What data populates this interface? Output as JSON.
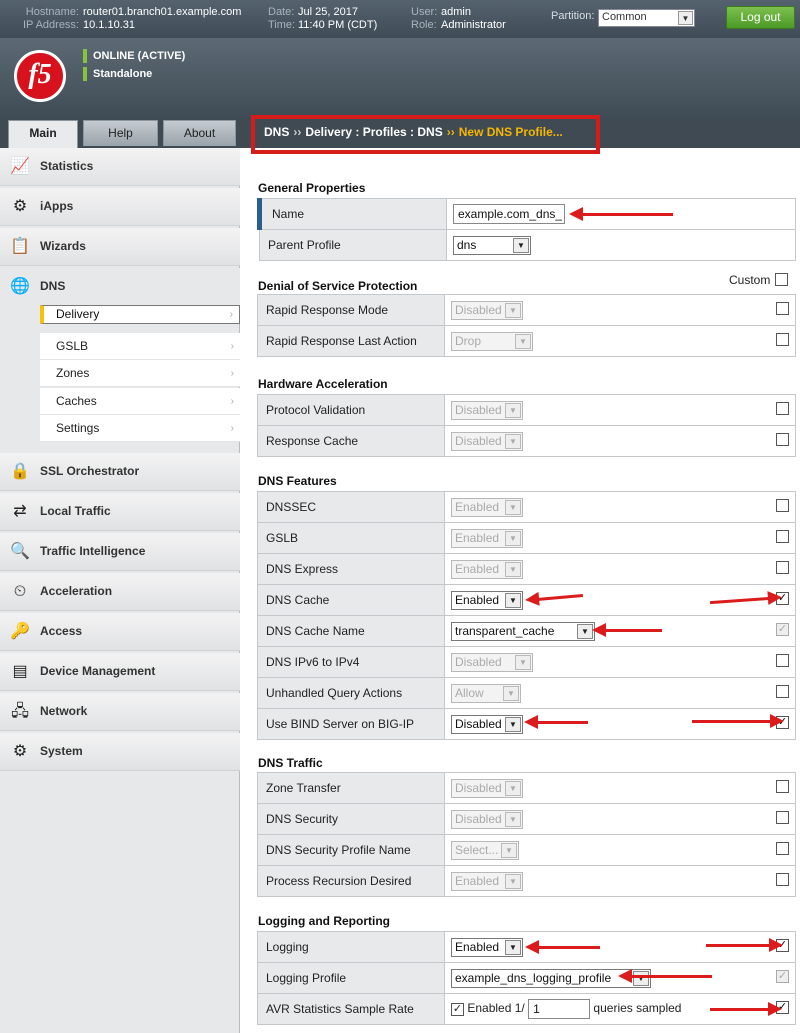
{
  "topbar": {
    "hostname_label": "Hostname:",
    "hostname": "router01.branch01.example.com",
    "ip_label": "IP Address:",
    "ip": "10.1.10.31",
    "date_label": "Date:",
    "date": "Jul 25, 2017",
    "time_label": "Time:",
    "time": "11:40 PM (CDT)",
    "user_label": "User:",
    "user": "admin",
    "role_label": "Role:",
    "role": "Administrator",
    "partition_label": "Partition:",
    "partition_value": "Common",
    "logout_label": "Log out"
  },
  "header": {
    "logo_text": "f5",
    "status_online": "ONLINE (ACTIVE)",
    "status_mode": "Standalone"
  },
  "tabs": [
    "Main",
    "Help",
    "About"
  ],
  "breadcrumb": {
    "parts": [
      "DNS",
      "Delivery : Profiles : DNS"
    ],
    "separator": "››",
    "current": "New DNS Profile..."
  },
  "sidebar": {
    "items": [
      {
        "label": "Statistics",
        "icon": "chart-icon"
      },
      {
        "label": "iApps",
        "icon": "iapps-icon"
      },
      {
        "label": "Wizards",
        "icon": "clipboard-icon"
      },
      {
        "label": "DNS",
        "icon": "globe-icon"
      },
      {
        "label": "SSL Orchestrator",
        "icon": "lock-icon"
      },
      {
        "label": "Local Traffic",
        "icon": "local-traffic-icon"
      },
      {
        "label": "Traffic Intelligence",
        "icon": "magnifier-icon"
      },
      {
        "label": "Acceleration",
        "icon": "gauge-icon"
      },
      {
        "label": "Access",
        "icon": "access-icon"
      },
      {
        "label": "Device Management",
        "icon": "device-icon"
      },
      {
        "label": "Network",
        "icon": "network-icon"
      },
      {
        "label": "System",
        "icon": "system-icon"
      }
    ],
    "dns_subitems": [
      "Delivery",
      "GSLB",
      "Zones",
      "Caches",
      "Settings"
    ],
    "selected_subitem": "Delivery"
  },
  "form": {
    "general": {
      "title": "General Properties",
      "name_label": "Name",
      "name_value": "example.com_dns_",
      "parent_label": "Parent Profile",
      "parent_value": "dns"
    },
    "dos": {
      "title": "Denial of Service Protection",
      "custom_label": "Custom",
      "rows": [
        {
          "label": "Rapid Response Mode",
          "value": "Disabled"
        },
        {
          "label": "Rapid Response Last Action",
          "value": "Drop"
        }
      ]
    },
    "hw": {
      "title": "Hardware Acceleration",
      "rows": [
        {
          "label": "Protocol Validation",
          "value": "Disabled"
        },
        {
          "label": "Response Cache",
          "value": "Disabled"
        }
      ]
    },
    "features": {
      "title": "DNS Features",
      "rows": [
        {
          "label": "DNSSEC",
          "value": "Enabled"
        },
        {
          "label": "GSLB",
          "value": "Enabled"
        },
        {
          "label": "DNS Express",
          "value": "Enabled"
        },
        {
          "label": "DNS Cache",
          "value": "Enabled"
        },
        {
          "label": "DNS Cache Name",
          "value": "transparent_cache"
        },
        {
          "label": "DNS IPv6 to IPv4",
          "value": "Disabled"
        },
        {
          "label": "Unhandled Query Actions",
          "value": "Allow"
        },
        {
          "label": "Use BIND Server on BIG-IP",
          "value": "Disabled"
        }
      ]
    },
    "traffic": {
      "title": "DNS Traffic",
      "rows": [
        {
          "label": "Zone Transfer",
          "value": "Disabled"
        },
        {
          "label": "DNS Security",
          "value": "Disabled"
        },
        {
          "label": "DNS Security Profile Name",
          "value": "Select..."
        },
        {
          "label": "Process Recursion Desired",
          "value": "Enabled"
        }
      ]
    },
    "logging": {
      "title": "Logging and Reporting",
      "rows": [
        {
          "label": "Logging",
          "value": "Enabled"
        },
        {
          "label": "Logging Profile",
          "value": "example_dns_logging_profile"
        },
        {
          "label": "AVR Statistics Sample Rate",
          "value": "1"
        }
      ],
      "avr_enabled_text": "Enabled 1/",
      "avr_suffix": "queries sampled"
    }
  },
  "checkmark": "✓",
  "colors": {
    "annotation": "#dc1c1c",
    "accent_bar": "#2c5f8e",
    "logout": "#5aa82e",
    "logo": "#d8121c"
  }
}
